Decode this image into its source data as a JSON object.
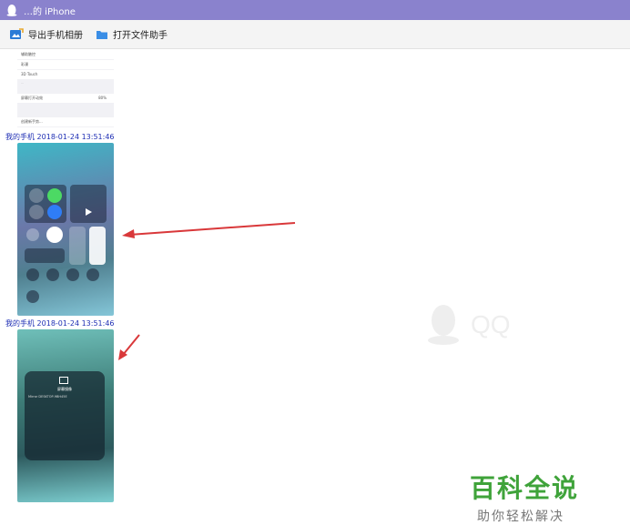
{
  "window": {
    "title": "…的 iPhone"
  },
  "toolbar": {
    "export_label": "导出手机相册",
    "open_helper_label": "打开文件助手"
  },
  "settings_card": {
    "rows": [
      "辅助触控",
      "彩漫",
      "3D Touch",
      "屏幕打开动效",
      "创建新手势..."
    ],
    "percent": "80%"
  },
  "messages": [
    {
      "sender": "我的手机",
      "time": "2018-01-24 13:51:46"
    },
    {
      "sender": "我的手机",
      "time": "2018-01-24 13:51:46"
    }
  ],
  "screen_mirror": {
    "title": "屏幕镜像",
    "device": "Mirror DESKTOP-9BH45E"
  },
  "watermark": {
    "text": "QQ"
  },
  "brand": {
    "name": "百科全说",
    "slogan": "助你轻松解决"
  },
  "colors": {
    "titlebar": "#8a82cd",
    "timestamp": "#1f2fb4",
    "arrow": "#d9383a",
    "brand": "#3fa33a"
  }
}
